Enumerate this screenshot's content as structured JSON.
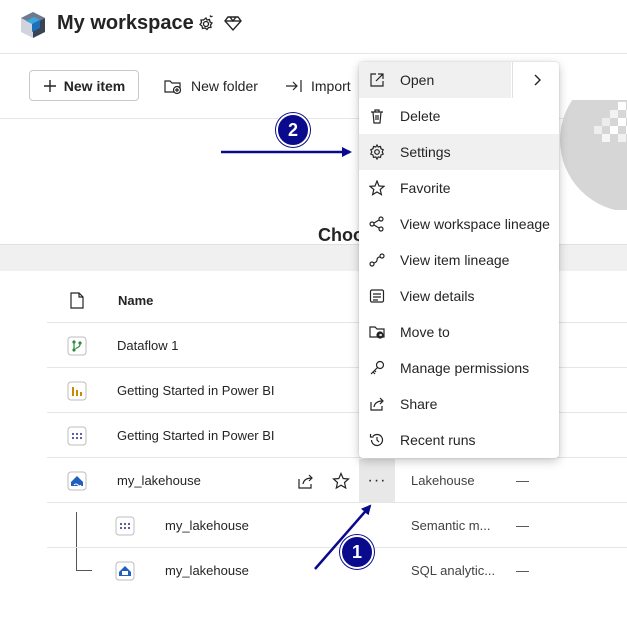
{
  "header": {
    "title": "My workspace",
    "icons": [
      "workspace-icon",
      "workspace-settings-icon",
      "premium-diamond-icon"
    ]
  },
  "toolbar": {
    "new_item_label": "New item",
    "new_folder_label": "New folder",
    "import_label": "Import"
  },
  "banner": {
    "heading": "Choose a task flow"
  },
  "table": {
    "name_header": "Name",
    "rows": [
      {
        "name": "Dataflow 1",
        "icon": "dataflow-icon",
        "type": "",
        "extra": ""
      },
      {
        "name": "Getting Started in Power BI",
        "icon": "report-icon",
        "type": "",
        "extra": ""
      },
      {
        "name": "Getting Started in Power BI",
        "icon": "semantic-model-icon",
        "type": "",
        "extra": ""
      },
      {
        "name": "my_lakehouse",
        "icon": "lakehouse-icon",
        "type": "Lakehouse",
        "extra": "—"
      },
      {
        "name": "my_lakehouse",
        "icon": "semantic-model-icon",
        "type": "Semantic m...",
        "extra": "—"
      },
      {
        "name": "my_lakehouse",
        "icon": "sql-endpoint-icon",
        "type": "SQL analytic...",
        "extra": "—"
      }
    ],
    "more_options_label": "···"
  },
  "context_menu": {
    "items": [
      {
        "label": "Open",
        "icon": "open-icon"
      },
      {
        "label": "Delete",
        "icon": "delete-icon"
      },
      {
        "label": "Settings",
        "icon": "settings-icon"
      },
      {
        "label": "Favorite",
        "icon": "star-icon"
      },
      {
        "label": "View workspace lineage",
        "icon": "workspace-lineage-icon"
      },
      {
        "label": "View item lineage",
        "icon": "item-lineage-icon"
      },
      {
        "label": "View details",
        "icon": "details-icon"
      },
      {
        "label": "Move to",
        "icon": "move-to-icon"
      },
      {
        "label": "Manage permissions",
        "icon": "key-icon"
      },
      {
        "label": "Share",
        "icon": "share-icon"
      },
      {
        "label": "Recent runs",
        "icon": "history-icon"
      }
    ],
    "submenu_chevron": "›"
  },
  "annotations": {
    "step1": "1",
    "step2": "2",
    "color": "#0a0a8c"
  }
}
